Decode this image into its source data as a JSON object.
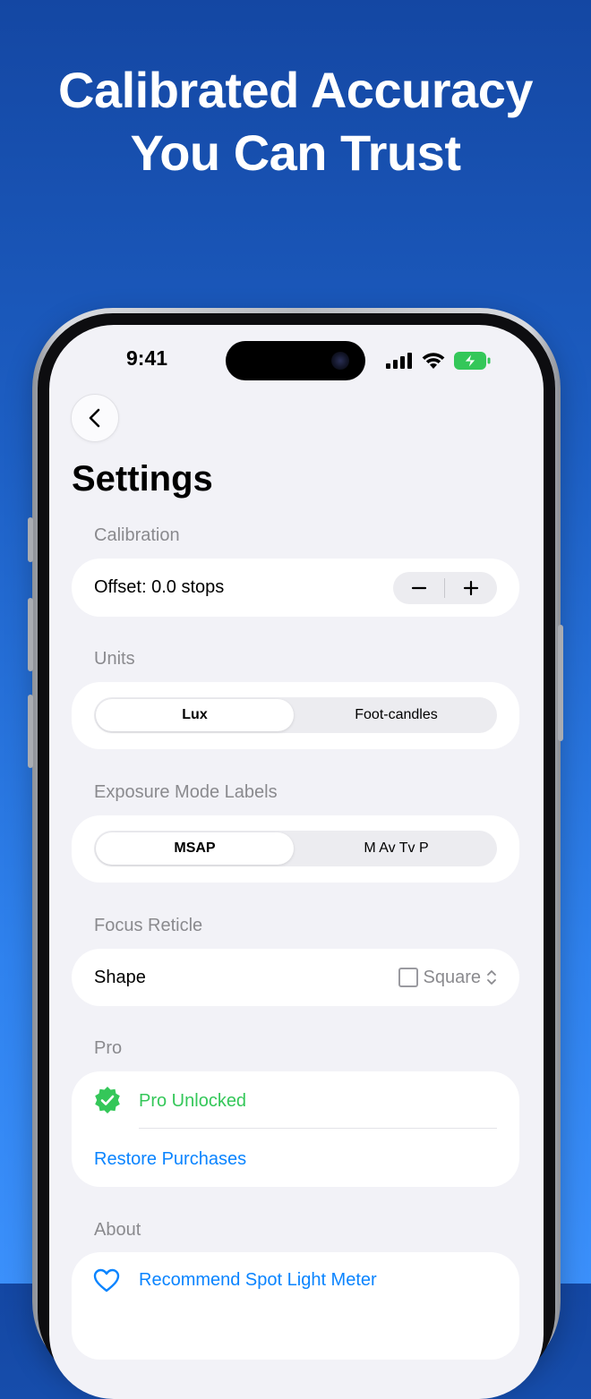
{
  "headline": {
    "line1": "Calibrated Accuracy",
    "line2": "You Can Trust"
  },
  "status_bar": {
    "time": "9:41",
    "icons": [
      "signal-icon",
      "wifi-icon",
      "battery-charging-icon"
    ]
  },
  "nav": {
    "back_icon": "chevron-left-icon"
  },
  "page_title": "Settings",
  "sections": {
    "calibration": {
      "header": "Calibration",
      "offset_label": "Offset: 0.0 stops",
      "decrement_label": "−",
      "increment_label": "+"
    },
    "units": {
      "header": "Units",
      "options": [
        "Lux",
        "Foot-candles"
      ],
      "selected": "Lux"
    },
    "exposure_mode_labels": {
      "header": "Exposure Mode Labels",
      "options": [
        "MSAP",
        "M Av Tv P"
      ],
      "selected": "MSAP"
    },
    "focus_reticle": {
      "header": "Focus Reticle",
      "shape_label": "Shape",
      "shape_value": "Square"
    },
    "pro": {
      "header": "Pro",
      "status": "Pro Unlocked",
      "restore": "Restore Purchases"
    },
    "about": {
      "header": "About",
      "recommend": "Recommend Spot Light Meter"
    }
  },
  "colors": {
    "accent_blue": "#0a84ff",
    "success_green": "#34c759",
    "background_gradient_top": "#1447a3",
    "background_gradient_bottom": "#3b90fb"
  }
}
